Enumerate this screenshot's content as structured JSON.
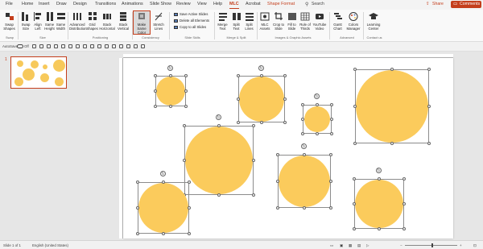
{
  "menu": {
    "tabs": [
      "File",
      "Home",
      "Insert",
      "Draw",
      "Design",
      "Transitions",
      "Animations",
      "Slide Show",
      "Review",
      "View",
      "Help",
      "MLC",
      "Acrobat",
      "Shape Format"
    ],
    "active_tab": "MLC",
    "search_label": "Search",
    "share_label": "Share",
    "comments_label": "Comments"
  },
  "ribbon": {
    "buttons": [
      {
        "label": "Swap Shapes"
      },
      {
        "label": "Swap Size"
      },
      {
        "label": "Align Left"
      },
      {
        "label": "Same Height"
      },
      {
        "label": "Same Width"
      },
      {
        "label": "Advanced Distribution"
      },
      {
        "label": "Grid Shapes"
      },
      {
        "label": "Stack Horizontal"
      },
      {
        "label": "Stack Vertical"
      },
      {
        "label": "Make Same Color"
      },
      {
        "label": "Stretch Lines"
      },
      {
        "label": "Merge Text"
      },
      {
        "label": "Split Text"
      },
      {
        "label": "Split Lines"
      },
      {
        "label": "MLC Assets"
      },
      {
        "label": "Crop to Slide"
      },
      {
        "label": "Fill to Slide"
      },
      {
        "label": "Rule of Thirds"
      },
      {
        "label": "YouTube Video"
      },
      {
        "label": "Gantt Chart"
      },
      {
        "label": "Colors Manager"
      },
      {
        "label": "Learning Center"
      }
    ],
    "small_buttons": [
      "Save Active Slides",
      "Delete all Elements",
      "Copy to all Slides"
    ],
    "groups": [
      "Swap",
      "Size",
      "Positioning",
      "Consistency",
      "Slide Skills",
      "Merge & Split",
      "Images & Graphic Assets",
      "Advanced",
      "Contact us"
    ]
  },
  "quick_access": {
    "autosave_label": "AutoSave",
    "autosave_state": "Off"
  },
  "thumbnails": {
    "slide_number": "1"
  },
  "status": {
    "slide_info": "Slide 1 of 1",
    "language": "English (United States)"
  },
  "colors": {
    "accent": "#c43e1c",
    "circle_fill": "#fbcb5c"
  }
}
